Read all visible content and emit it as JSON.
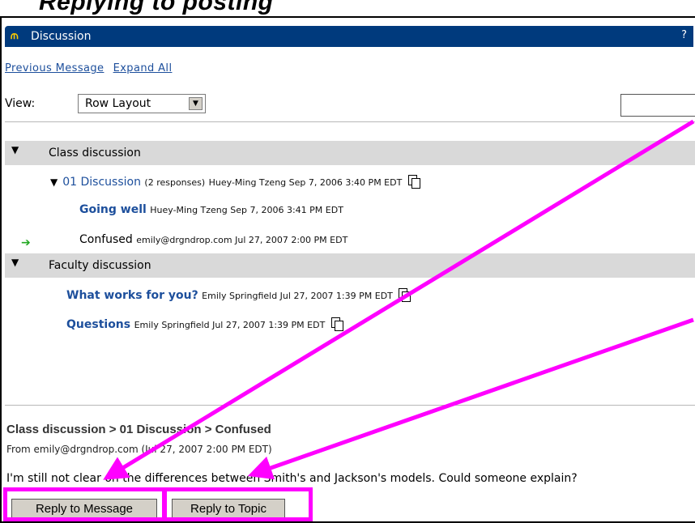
{
  "page_heading": "Replying to posting",
  "window": {
    "title": "Discussion",
    "help": "?"
  },
  "links": {
    "previous": "Previous Message",
    "expand": "Expand All"
  },
  "view": {
    "label": "View:",
    "selected": "Row Layout"
  },
  "groups": [
    {
      "label": "Class discussion",
      "topic": {
        "title": "01 Discussion",
        "responses": "(2 responses)",
        "meta": "Huey-Ming Tzeng Sep 7, 2006 3:40 PM EDT"
      },
      "messages": [
        {
          "title": "Going well",
          "meta": "Huey-Ming Tzeng Sep 7, 2006 3:41 PM EDT"
        },
        {
          "title": "Confused",
          "meta": "emily@drgndrop.com Jul 27, 2007 2:00 PM EDT"
        }
      ]
    },
    {
      "label": "Faculty discussion",
      "messages": [
        {
          "title": "What works for you?",
          "meta": "Emily Springfield Jul 27, 2007 1:39 PM EDT"
        },
        {
          "title": "Questions",
          "meta": "Emily Springfield Jul 27, 2007 1:39 PM EDT"
        }
      ]
    }
  ],
  "detail": {
    "path": "Class discussion > 01 Discussion > Confused",
    "from": "From emily@drgndrop.com (Jul 27, 2007 2:00 PM EDT)",
    "body": "I'm still not clear on the differences between Smith's and Jackson's models. Could someone explain?"
  },
  "buttons": {
    "reply_message": "Reply to Message",
    "reply_topic": "Reply to Topic"
  },
  "colors": {
    "title_bar": "#003a7d",
    "link": "#1d4f9c",
    "highlight": "#ff00ff",
    "group_bg": "#d9d9d9"
  }
}
